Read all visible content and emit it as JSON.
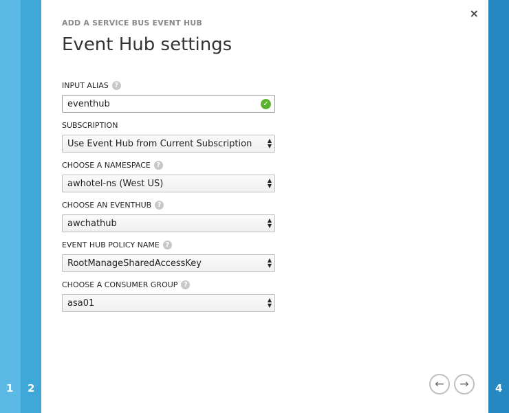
{
  "wizard": {
    "steps": [
      "1",
      "2",
      "4"
    ],
    "close_icon": "×",
    "subtitle": "ADD A SERVICE BUS EVENT HUB",
    "title": "Event Hub settings"
  },
  "fields": {
    "input_alias": {
      "label": "INPUT ALIAS",
      "value": "eventhub",
      "status": "valid"
    },
    "subscription": {
      "label": "SUBSCRIPTION",
      "value": "Use Event Hub from Current Subscription"
    },
    "namespace": {
      "label": "CHOOSE A NAMESPACE",
      "value": "awhotel-ns (West US)"
    },
    "eventhub": {
      "label": "CHOOSE AN EVENTHUB",
      "value": "awchathub"
    },
    "policy": {
      "label": "EVENT HUB POLICY NAME",
      "value": "RootManageSharedAccessKey"
    },
    "consumer_group": {
      "label": "CHOOSE A CONSUMER GROUP",
      "value": "asa01"
    }
  },
  "navigation": {
    "back_icon": "←",
    "next_icon": "→"
  },
  "colors": {
    "rail_step1": "#5cb9e4",
    "rail_step2": "#3fa8d8",
    "rail_step4": "#2588c0",
    "valid_check": "#5bb32e"
  }
}
